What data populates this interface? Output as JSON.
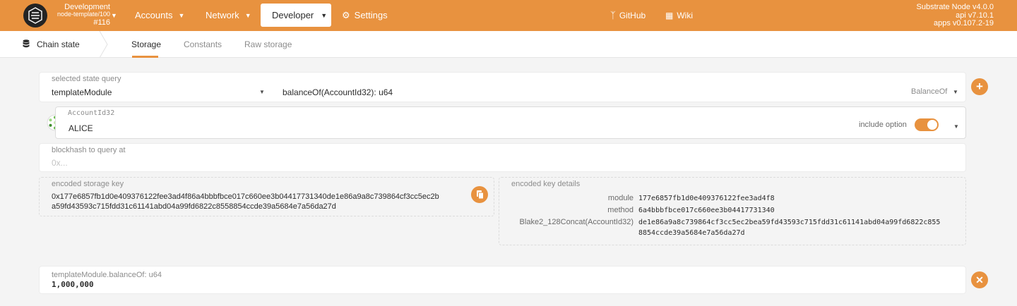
{
  "topbar": {
    "chain": {
      "name": "Development",
      "node": "node-template/100",
      "block": "#116"
    },
    "nav": [
      {
        "label": "Accounts"
      },
      {
        "label": "Network"
      },
      {
        "label": "Developer"
      },
      {
        "label": "Settings"
      }
    ],
    "links": [
      {
        "label": "GitHub"
      },
      {
        "label": "Wiki"
      }
    ],
    "versions": {
      "node": "Substrate Node v4.0.0",
      "api": "api v7.10.1",
      "apps": "apps v0.107.2-19"
    }
  },
  "subbar": {
    "title": "Chain state",
    "tabs": [
      {
        "label": "Storage"
      },
      {
        "label": "Constants"
      },
      {
        "label": "Raw storage"
      }
    ]
  },
  "query": {
    "label": "selected state query",
    "module": "templateModule",
    "method": "balanceOf(AccountId32): u64",
    "method_short": "BalanceOf"
  },
  "account": {
    "label": "AccountId32",
    "value": "ALICE",
    "include_option_label": "include option",
    "include_option_on": true
  },
  "blockhash": {
    "label": "blockhash to query at",
    "placeholder": "0x..."
  },
  "encoded_key": {
    "label": "encoded storage key",
    "line1": "0x177e6857fb1d0e409376122fee3ad4f86a4bbbfbce017c660ee3b04417731340de1e86a9a8c739864cf3cc5ec2b",
    "line2": "a59fd43593c715fdd31c61141abd04a99fd6822c8558854ccde39a5684e7a56da27d"
  },
  "key_details": {
    "label": "encoded key details",
    "rows": [
      {
        "key": "module",
        "value": "177e6857fb1d0e409376122fee3ad4f8"
      },
      {
        "key": "method",
        "value": "6a4bbbfbce017c660ee3b04417731340"
      },
      {
        "key": "Blake2_128Concat(AccountId32)",
        "value": "de1e86a9a8c739864cf3cc5ec2bea59fd43593c715fdd31c61141abd04a99fd6822c855",
        "value2": "8854ccde39a5684e7a56da27d"
      }
    ]
  },
  "result": {
    "label": "templateModule.balanceOf: u64",
    "value": "1,000,000"
  },
  "colors": {
    "accent": "#e8923f",
    "background": "#f4f4f4"
  },
  "icons": [
    "node-logo",
    "settings-icon",
    "github-icon",
    "wiki-icon",
    "database-icon",
    "add-icon",
    "identicon",
    "copy-icon",
    "close-icon"
  ]
}
